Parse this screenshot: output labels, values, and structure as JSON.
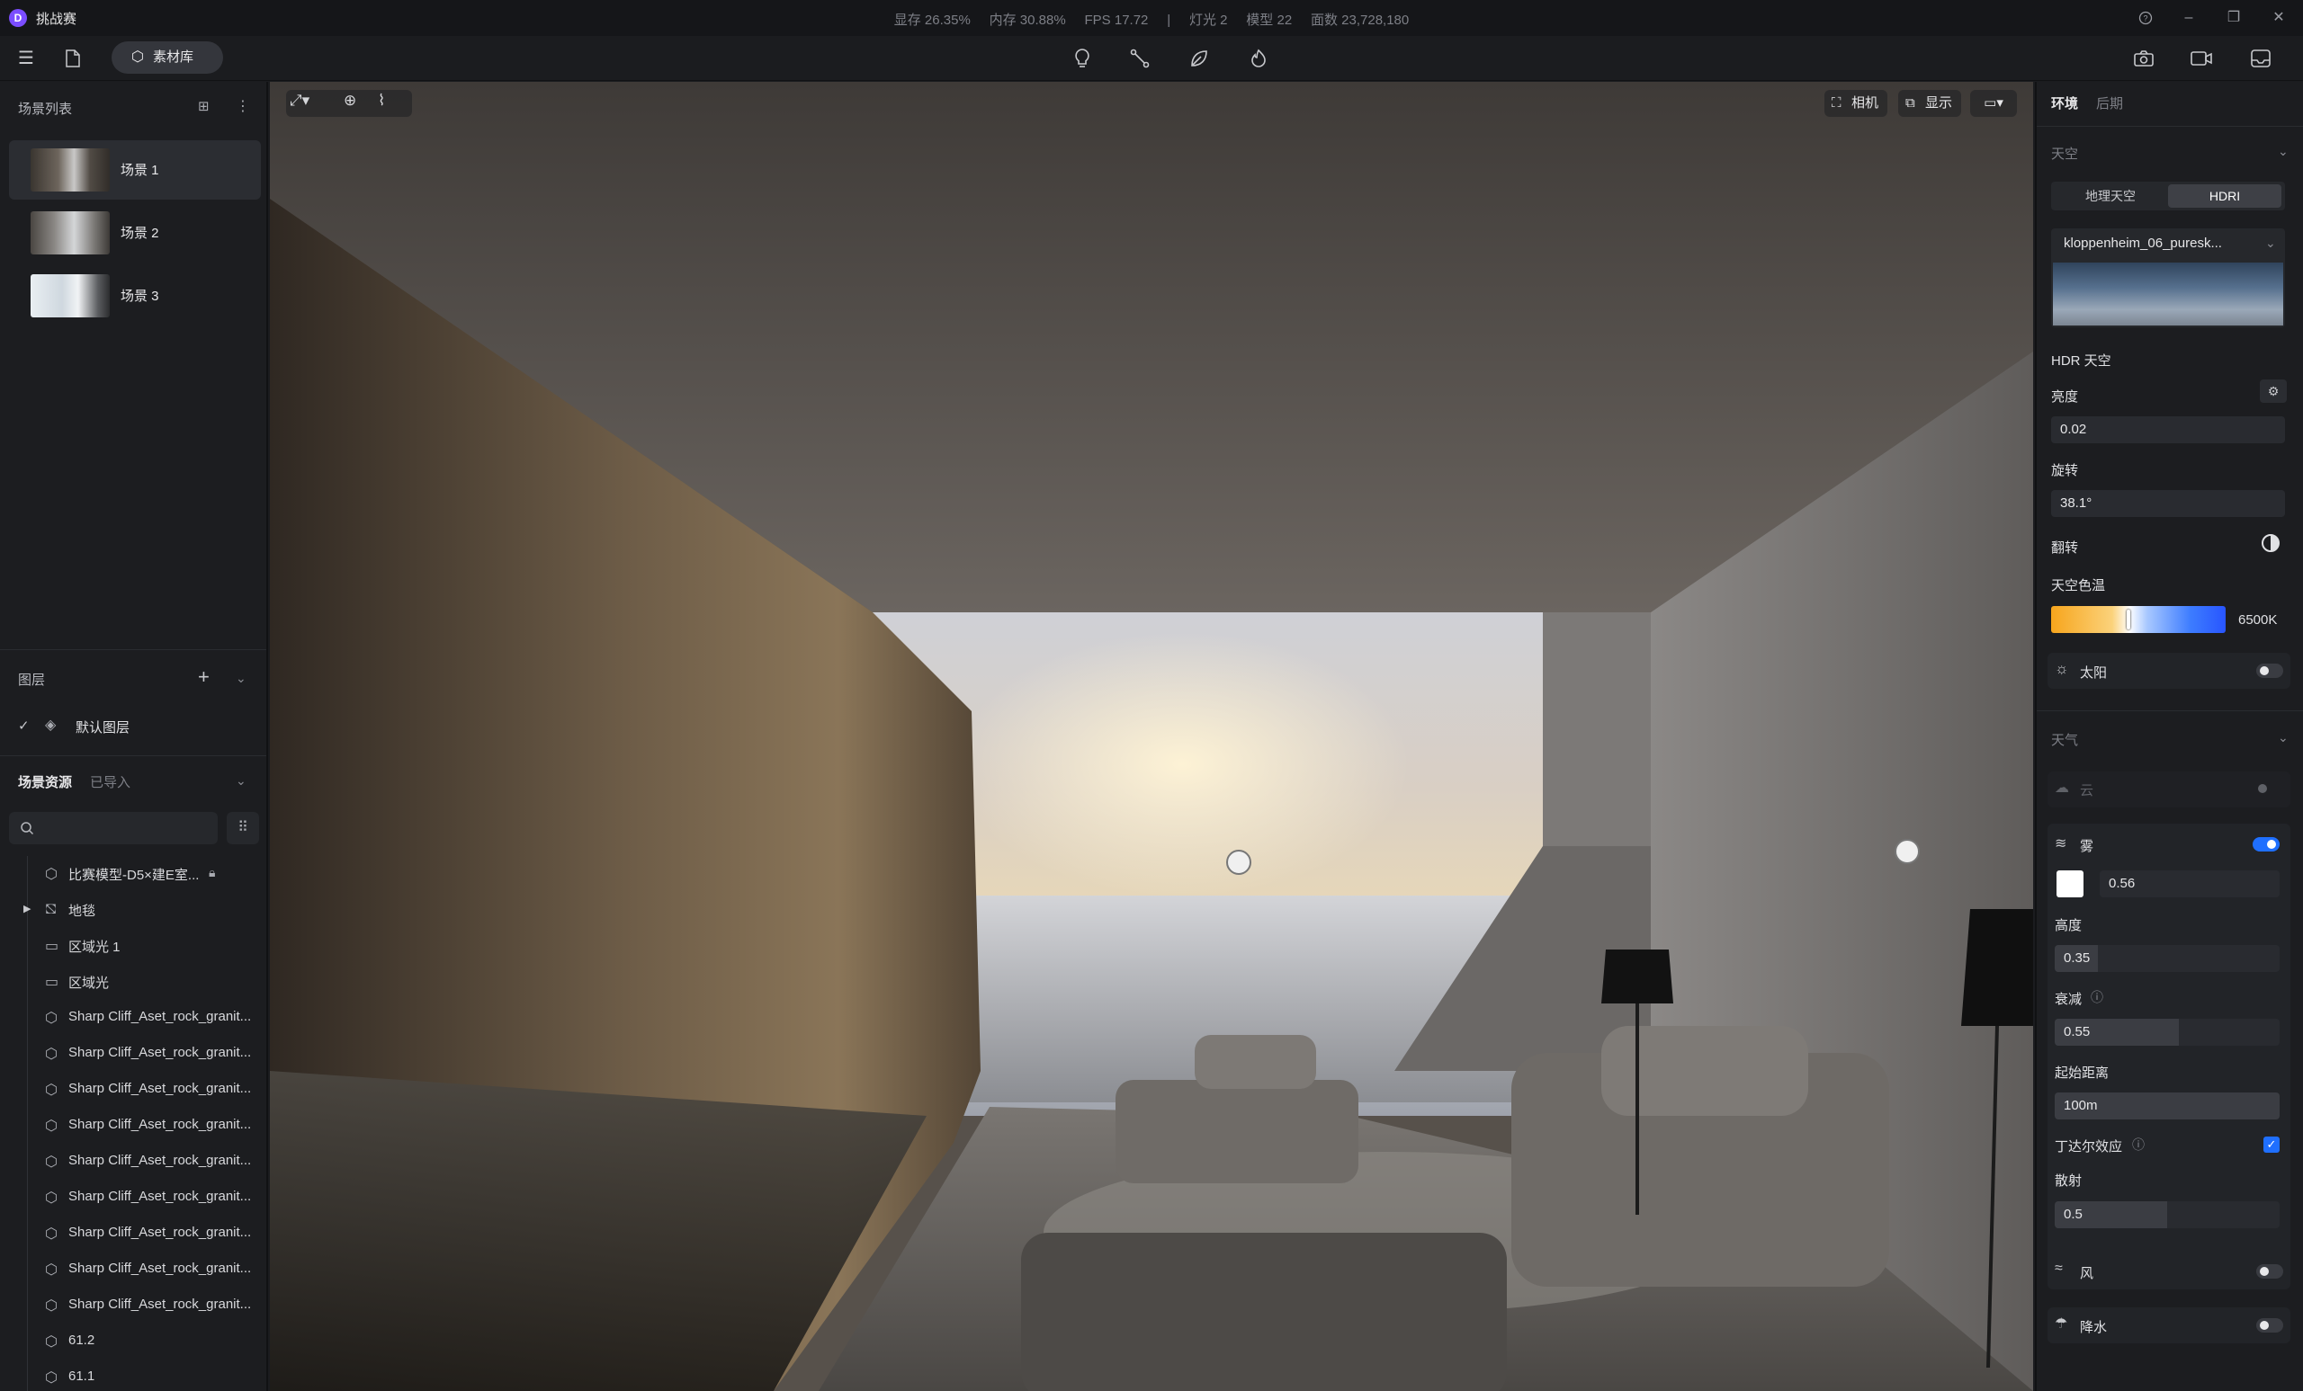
{
  "app": {
    "logo_letter": "D",
    "title": "挑战赛"
  },
  "stats": {
    "text": "显存 26.35%     内存 30.88%     FPS 17.72     |     灯光 2     模型 22     面数 23,728,180"
  },
  "toolbar": {
    "library_label": "素材库"
  },
  "scenes": {
    "title": "场景列表",
    "items": [
      {
        "label": "场景 1",
        "active": true
      },
      {
        "label": "场景 2",
        "active": false
      },
      {
        "label": "场景 3",
        "active": false
      }
    ]
  },
  "layers": {
    "title": "图层",
    "default_layer": "默认图层"
  },
  "resources": {
    "tab_scene": "场景资源",
    "tab_imported": "已导入",
    "items": [
      "比赛模型-D5×建E室...",
      "地毯",
      "区域光 1",
      "区域光",
      "Sharp Cliff_Aset_rock_granit...",
      "Sharp Cliff_Aset_rock_granit...",
      "Sharp Cliff_Aset_rock_granit...",
      "Sharp Cliff_Aset_rock_granit...",
      "Sharp Cliff_Aset_rock_granit...",
      "Sharp Cliff_Aset_rock_granit...",
      "Sharp Cliff_Aset_rock_granit...",
      "Sharp Cliff_Aset_rock_granit...",
      "Sharp Cliff_Aset_rock_granit...",
      "61.2",
      "61.1"
    ]
  },
  "viewport": {
    "camera_label": "相机",
    "display_label": "显示"
  },
  "right_panel": {
    "tab_env": "环境",
    "tab_post": "后期",
    "sky": {
      "title": "天空",
      "mode_geo": "地理天空",
      "mode_hdri": "HDRI",
      "hdri_file": "kloppenheim_06_puresk...",
      "hdr_sky_label": "HDR 天空",
      "brightness_label": "亮度",
      "brightness_value": "0.02",
      "rotation_label": "旋转",
      "rotation_value": "38.1°",
      "flip_label": "翻转",
      "color_temp_label": "天空色温",
      "color_temp_value": "6500K",
      "sun_label": "太阳"
    },
    "weather": {
      "title": "天气",
      "cloud_label": "云",
      "fog_label": "雾",
      "fog_density": "0.56",
      "fog_height_label": "高度",
      "fog_height": "0.35",
      "fog_height_fraction": 0.19,
      "falloff_label": "衰减",
      "falloff": "0.55",
      "falloff_fraction": 0.55,
      "start_dist_label": "起始距离",
      "start_dist": "100m",
      "tyndall_label": "丁达尔效应",
      "scatter_label": "散射",
      "scatter": "0.5",
      "scatter_fraction": 0.5,
      "wind_label": "风",
      "precip_label": "降水"
    }
  }
}
